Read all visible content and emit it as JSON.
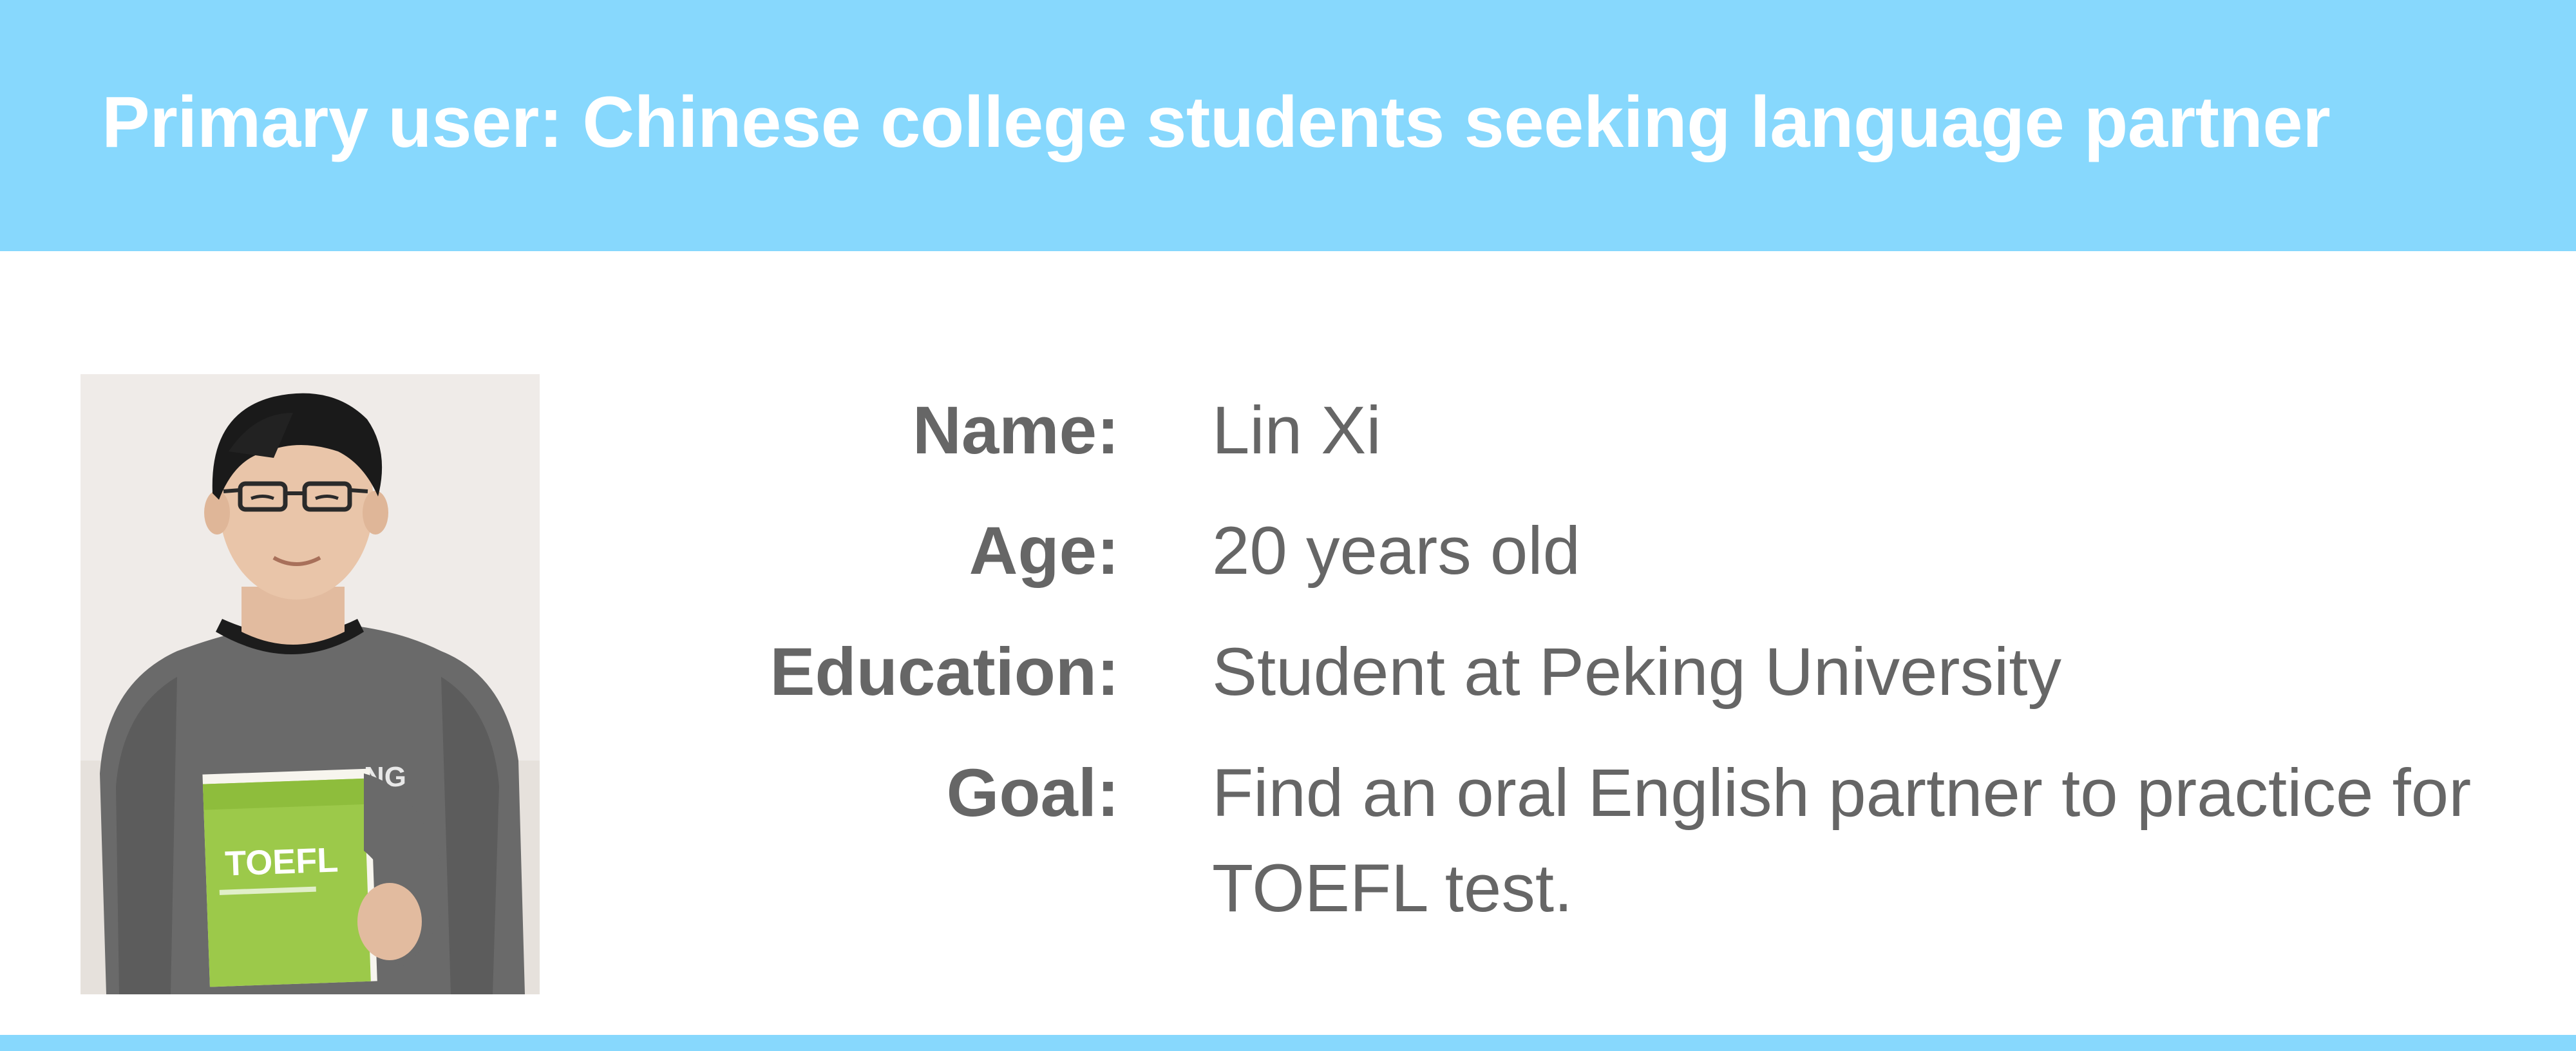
{
  "header": {
    "title": "Primary user: Chinese college students seeking language partner"
  },
  "profile": {
    "photo": {
      "book_label": "TOEFL",
      "shirt_text": "NG"
    },
    "fields": [
      {
        "label": "Name:",
        "value": "Lin Xi"
      },
      {
        "label": "Age:",
        "value": "20 years old"
      },
      {
        "label": "Education:",
        "value": "Student at Peking University"
      },
      {
        "label": "Goal:",
        "value": "Find an oral English partner to practice for TOEFL test."
      }
    ]
  },
  "colors": {
    "accent": "#87d8fd",
    "text": "#666666",
    "background": "#ffffff"
  }
}
